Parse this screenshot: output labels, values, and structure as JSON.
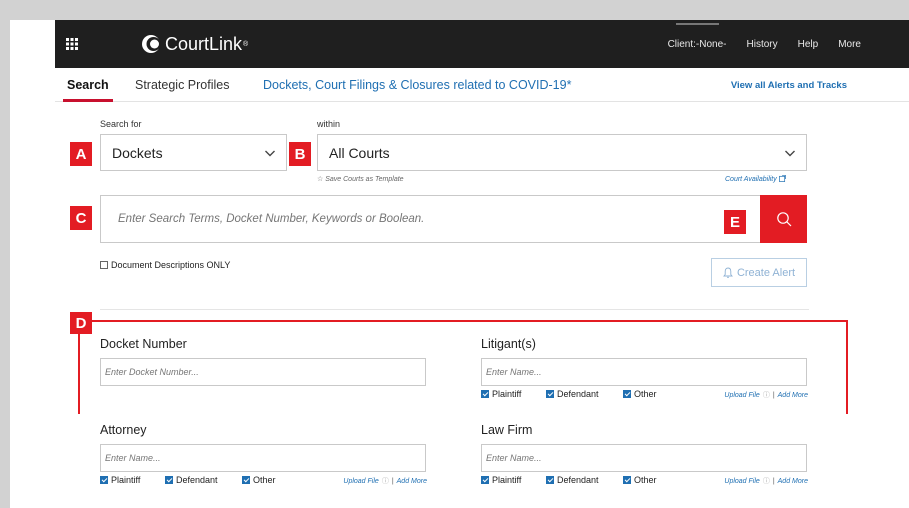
{
  "navbar": {
    "brand": "CourtLink",
    "brand_mark": "®",
    "items": [
      "Client:-None-",
      "History",
      "Help",
      "More"
    ]
  },
  "tabs": {
    "search": "Search",
    "profiles": "Strategic Profiles",
    "covid": "Dockets, Court Filings & Closures related to COVID-19*",
    "view_alerts": "View all Alerts and Tracks"
  },
  "form": {
    "search_for_label": "Search for",
    "within_label": "within",
    "search_for_value": "Dockets",
    "within_value": "All Courts",
    "save_template": "☆ Save Courts as Template",
    "court_availability": "Court Availability",
    "search_placeholder": "Enter Search Terms, Docket Number, Keywords or Boolean.",
    "doc_desc_only": "Document Descriptions ONLY",
    "create_alert": "Create Alert"
  },
  "badges": {
    "a": "A",
    "b": "B",
    "c": "C",
    "d": "D",
    "e": "E"
  },
  "fields": {
    "docket": {
      "title": "Docket Number",
      "placeholder": "Enter Docket Number..."
    },
    "litigants": {
      "title": "Litigant(s)",
      "placeholder": "Enter Name..."
    },
    "attorney": {
      "title": "Attorney",
      "placeholder": "Enter Name..."
    },
    "lawfirm": {
      "title": "Law Firm",
      "placeholder": "Enter Name..."
    }
  },
  "roles": {
    "plaintiff": "Plaintiff",
    "defendant": "Defendant",
    "other": "Other",
    "upload_file": "Upload File",
    "info": "ⓘ",
    "separator": "|",
    "add_more": "Add More"
  },
  "colors": {
    "accent_red": "#e31c23",
    "link_blue": "#1f6fb2",
    "navbar_bg": "#1f1f1f"
  }
}
